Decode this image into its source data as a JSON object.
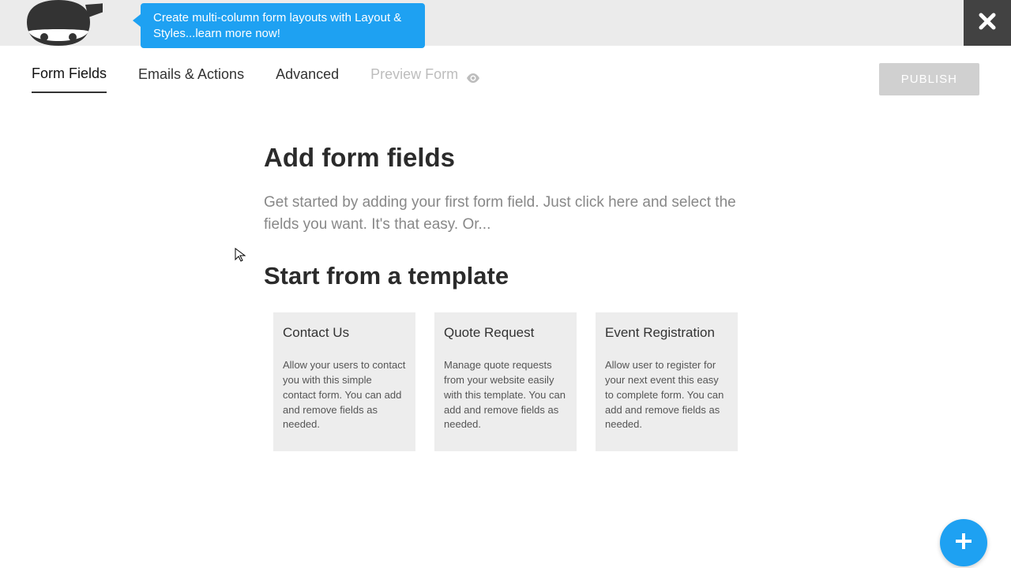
{
  "promo": {
    "text": "Create multi-column form layouts with Layout & Styles...learn more now!"
  },
  "tabs": {
    "form_fields": "Form Fields",
    "emails_actions": "Emails & Actions",
    "advanced": "Advanced",
    "preview": "Preview Form"
  },
  "publish": {
    "label": "PUBLISH"
  },
  "main": {
    "heading1": "Add form fields",
    "subtext": "Get started by adding your first form field. Just click here and select the fields you want. It's that easy. Or...",
    "heading2": "Start from a template"
  },
  "templates": [
    {
      "title": "Contact Us",
      "desc": "Allow your users to contact you with this simple contact form. You can add and remove fields as needed."
    },
    {
      "title": "Quote Request",
      "desc": "Manage quote requests from your website easily with this template. You can add and remove fields as needed."
    },
    {
      "title": "Event Registration",
      "desc": "Allow user to register for your next event this easy to complete form. You can add and remove fields as needed."
    }
  ]
}
